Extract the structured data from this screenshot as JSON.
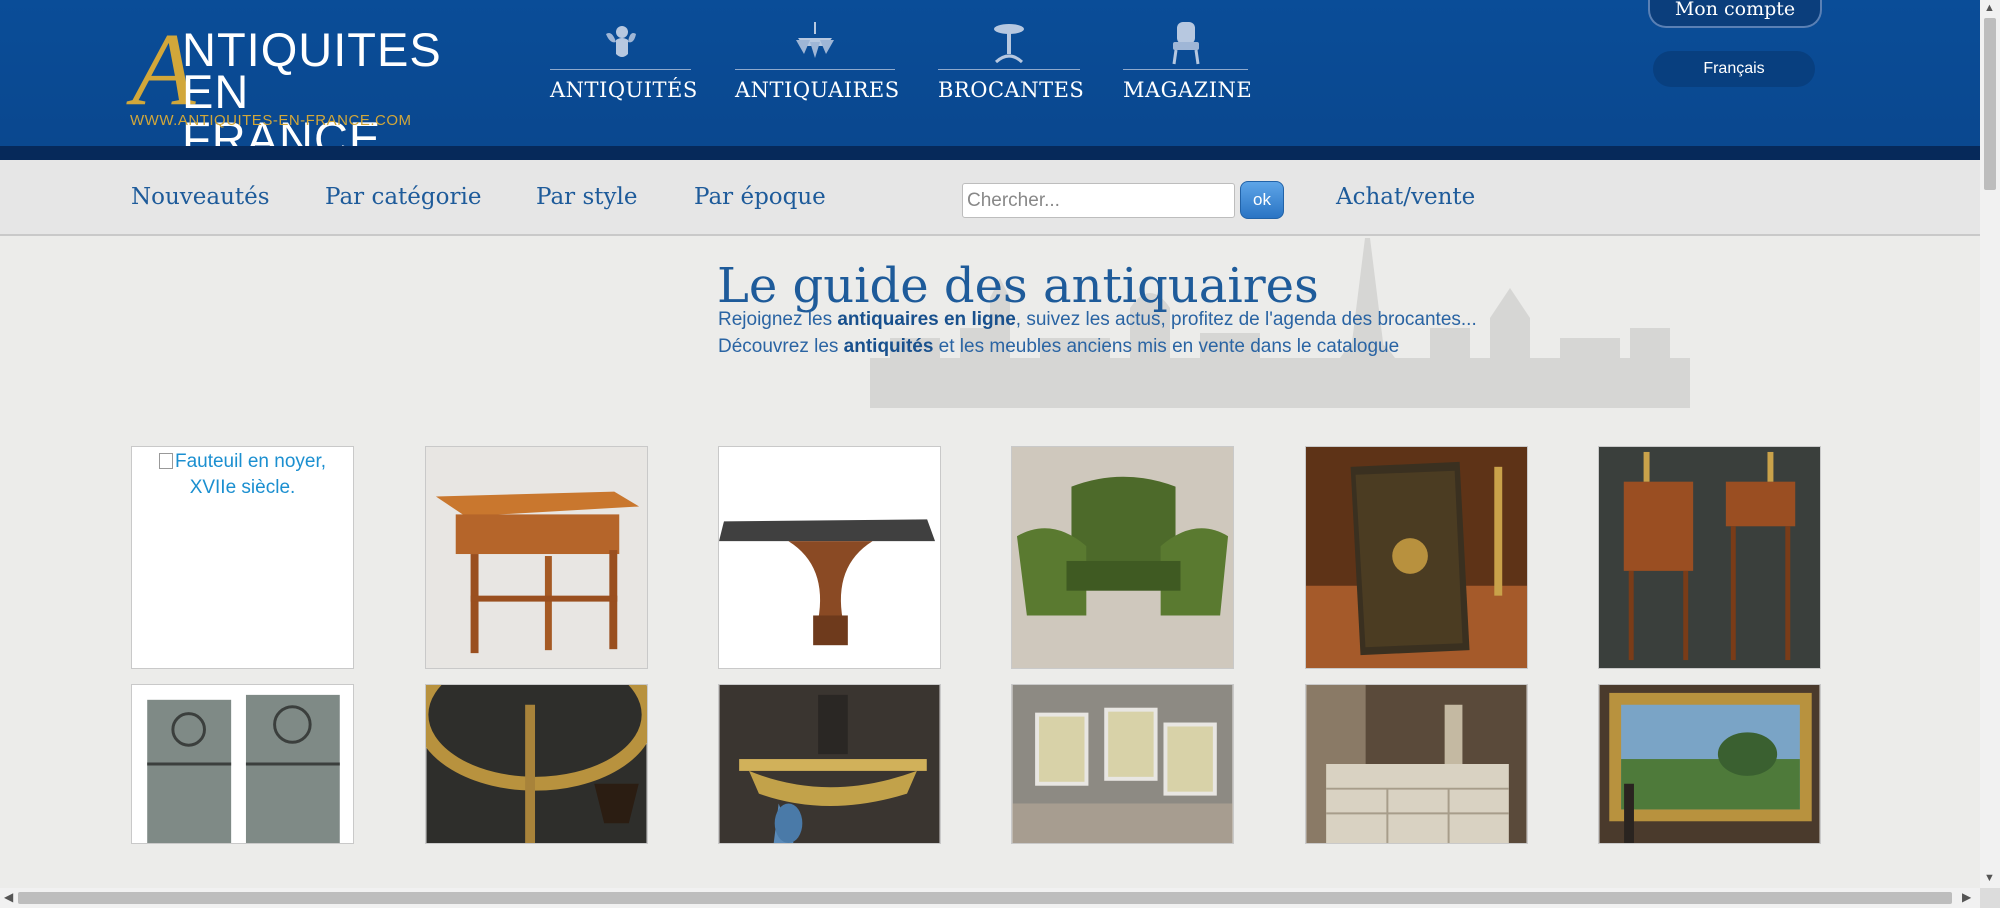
{
  "brand": {
    "logo_letter": "A",
    "logo_line1": "NTIQUITES",
    "logo_line2": "EN FRANCE",
    "url": "WWW.ANTIQUITES-EN-FRANCE.COM",
    "colors": {
      "header_blue": "#0a4d98",
      "gold": "#d2a73a",
      "link_blue": "#1e5b9a"
    }
  },
  "main_nav": [
    {
      "label": "ANTIQUITÉS",
      "icon": "cherub-icon"
    },
    {
      "label": "ANTIQUAIRES",
      "icon": "chandelier-icon"
    },
    {
      "label": "BROCANTES",
      "icon": "pedestal-table-icon"
    },
    {
      "label": "MAGAZINE",
      "icon": "armchair-icon"
    }
  ],
  "account": {
    "label": "Mon compte"
  },
  "language": {
    "label": "Français"
  },
  "subnav": {
    "links": [
      "Nouveautés",
      "Par catégorie",
      "Par style",
      "Par époque"
    ],
    "search_placeholder": "Chercher...",
    "search_button": "ok",
    "achat_vente": "Achat/vente"
  },
  "hero": {
    "title": "Le guide des antiquaires",
    "line1": {
      "pre": "Rejoignez les ",
      "bold": "antiquaires en ligne",
      "post": ", suivez les actus, profitez de l'agenda des brocantes..."
    },
    "line2": {
      "pre": "Découvrez les ",
      "bold": "antiquités",
      "post": " et les meubles anciens mis en vente dans le catalogue"
    }
  },
  "products": [
    {
      "alt": "Fauteuil en noyer, XVIIe siècle.",
      "icon": "broken-image-icon"
    },
    {
      "icon": "wooden-table-icon"
    },
    {
      "icon": "glass-table-icon"
    },
    {
      "icon": "green-armchairs-icon"
    },
    {
      "icon": "book-wastebasket-icon"
    },
    {
      "icon": "bedside-tables-icon"
    },
    {
      "icon": "iron-gates-icon"
    },
    {
      "icon": "gilt-mirror-icon"
    },
    {
      "icon": "console-table-icon"
    },
    {
      "icon": "white-armchairs-icon"
    },
    {
      "icon": "chest-of-drawers-icon"
    },
    {
      "icon": "landscape-painting-icon"
    }
  ]
}
